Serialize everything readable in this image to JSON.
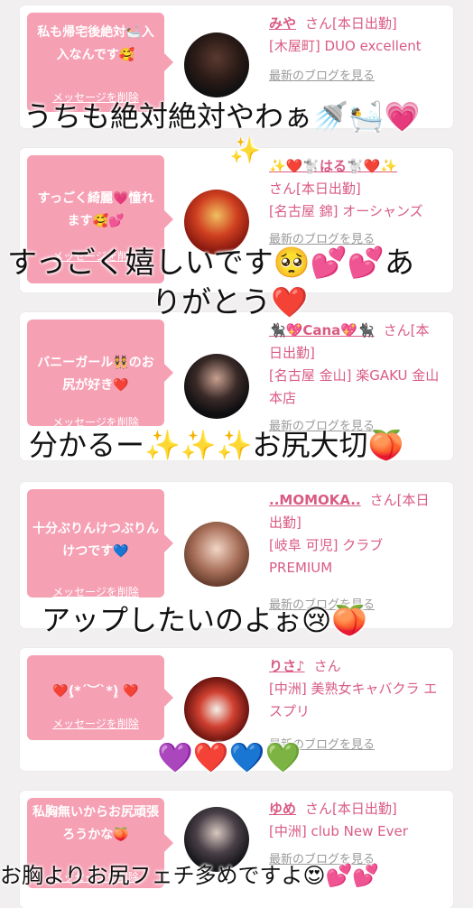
{
  "colors": {
    "bubble": "#f6a0b4",
    "accent": "#d95b83",
    "blog": "#9a9a9a"
  },
  "cards": [
    {
      "message": "私も帰宅後絶対🛀入入なんです🥰",
      "delete_label": "メッセージを削除",
      "name": "みや",
      "status": "さん[本日出勤]",
      "shop": "[木屋町] DUO excellent",
      "blog": "最新のブログを見る"
    },
    {
      "message": "すっごく綺麗💗憧れます🥰💕",
      "delete_label": "メッセージを削除",
      "name": "✨❤️🐩はる🐩❤️✨",
      "status": "さん[本日出勤]",
      "shop": "[名古屋 錦] オーシャンズ",
      "blog": "最新のブログを見る"
    },
    {
      "message": "バニーガール👯のお尻が好き❤️",
      "delete_label": "メッセージを削除",
      "name": "🐈‍⬛💖Cana💖🐈‍⬛",
      "status": "さん[本日出勤]",
      "shop": "[名古屋 金山] 楽GAKU 金山本店",
      "blog": "最新のブログを見る"
    },
    {
      "message": "十分ぶりんけつぶりんけつです💙",
      "delete_label": "メッセージを削除",
      "name": "..MOMOKA..",
      "status": "さん[本日出勤]",
      "shop": "[岐阜 可児] クラブ PREMIUM",
      "blog": "最新のブログを見る"
    },
    {
      "message": "❤️ٍ(*´︶`*)ٍ ❤️",
      "delete_label": "メッセージを削除",
      "name": "りさ♪",
      "status": "さん",
      "shop": "[中洲] 美熟女キャバクラ エスプリ",
      "blog": "最新のブログを見る"
    },
    {
      "message": "私胸無いからお尻頑張ろうかな🍑",
      "delete_label": "メッセージを削除",
      "name": "ゆめ",
      "status": "さん[本日出勤]",
      "shop": "[中洲] club New Ever",
      "blog": "最新のブログを見る"
    }
  ],
  "captions": [
    "うちも絶対絶対やわぁ🚿🛀💗",
    "✨",
    "すっごく嬉しいです🥺💕💕あ",
    "りがとう❤️",
    "分かるー✨✨✨お尻大切🍑",
    "アップしたいのよぉ😢🍑",
    "💜❤️💙💚",
    "お胸よりお尻フェチ多めですよ😍💕💕"
  ]
}
